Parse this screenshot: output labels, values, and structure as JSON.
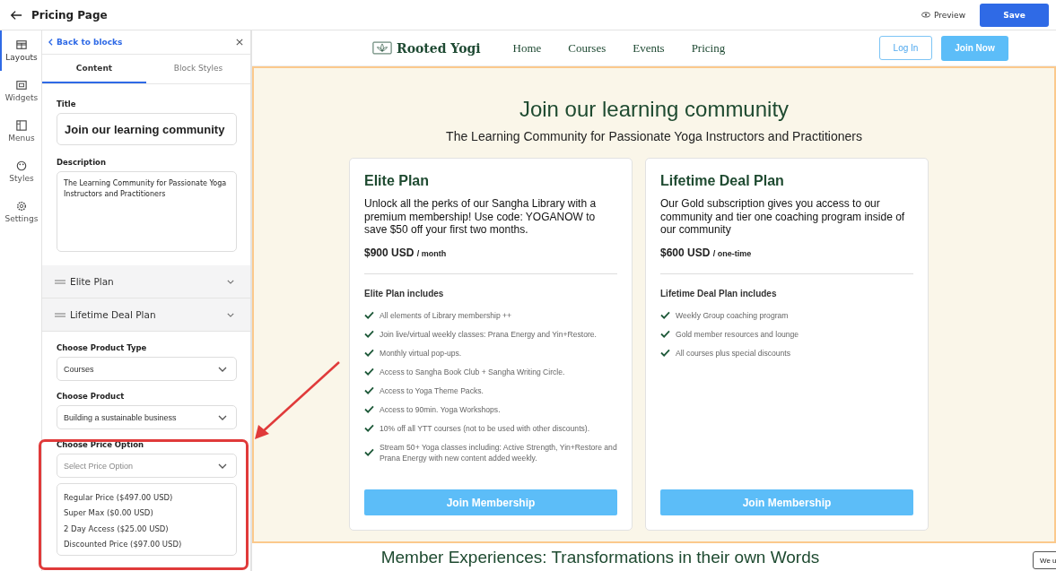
{
  "top_bar": {
    "title": "Pricing Page",
    "preview": "Preview",
    "save": "Save"
  },
  "rail": [
    {
      "label": "Layouts",
      "selected": true
    },
    {
      "label": "Widgets",
      "selected": false
    },
    {
      "label": "Menus",
      "selected": false
    },
    {
      "label": "Styles",
      "selected": false
    },
    {
      "label": "Settings",
      "selected": false
    }
  ],
  "panel": {
    "back": "Back to blocks",
    "tabs": [
      {
        "label": "Content",
        "selected": true
      },
      {
        "label": "Block Styles",
        "selected": false
      }
    ],
    "title_field": {
      "label": "Title",
      "value": "Join our learning community"
    },
    "description_field": {
      "label": "Description",
      "value": "The Learning Community for Passionate Yoga Instructors and Practitioners"
    },
    "plans": [
      "Elite Plan",
      "Lifetime Deal Plan"
    ],
    "product_type": {
      "label": "Choose Product Type",
      "value": "Courses"
    },
    "product": {
      "label": "Choose Product",
      "value": "Building a sustainable business"
    },
    "price_option": {
      "label": "Choose Price Option",
      "placeholder": "Select Price Option",
      "options": [
        "Regular Price ($497.00 USD)",
        "Super Max ($0.00 USD)",
        "2 Day Access ($25.00 USD)",
        "Discounted Price ($97.00 USD)"
      ]
    }
  },
  "site": {
    "logo": "Rooted Yogi",
    "nav": [
      "Home",
      "Courses",
      "Events",
      "Pricing"
    ],
    "login": "Log In",
    "join": "Join Now"
  },
  "hero": {
    "title": "Join our learning community",
    "subtitle": "The Learning Community for Passionate Yoga Instructors and Practitioners",
    "cards": [
      {
        "name": "Elite Plan",
        "description": "Unlock all the perks of our Sangha Library with a premium membership! Use code: YOGANOW to save $50 off your first two months.",
        "price": "$900 USD",
        "period": "/ month",
        "includes": "Elite Plan includes",
        "features": [
          "All elements of Library membership ++",
          "Join live/virtual weekly classes: Prana Energy and Yin+Restore.",
          "Monthly virtual pop-ups.",
          "Access to Sangha Book Club + Sangha Writing Circle.",
          "Access to Yoga Theme Packs.",
          "Access to 90min. Yoga Workshops.",
          "10% off all YTT courses (not to be used with other discounts).",
          "Stream 50+ Yoga classes including: Active Strength, Yin+Restore and Prana Energy with new content added weekly."
        ],
        "button": "Join Membership"
      },
      {
        "name": "Lifetime Deal Plan",
        "description": "Our Gold subscription gives you access to our community and tier one coaching program inside of our community",
        "price": "$600 USD",
        "period": "/ one-time",
        "includes": "Lifetime Deal Plan includes",
        "features": [
          "Weekly Group coaching program",
          "Gold member resources and lounge",
          "All courses plus special discounts"
        ],
        "button": "Join Membership"
      }
    ]
  },
  "next_heading": "Member Experiences: Transformations in their own Words",
  "cookie_notice": "We u"
}
